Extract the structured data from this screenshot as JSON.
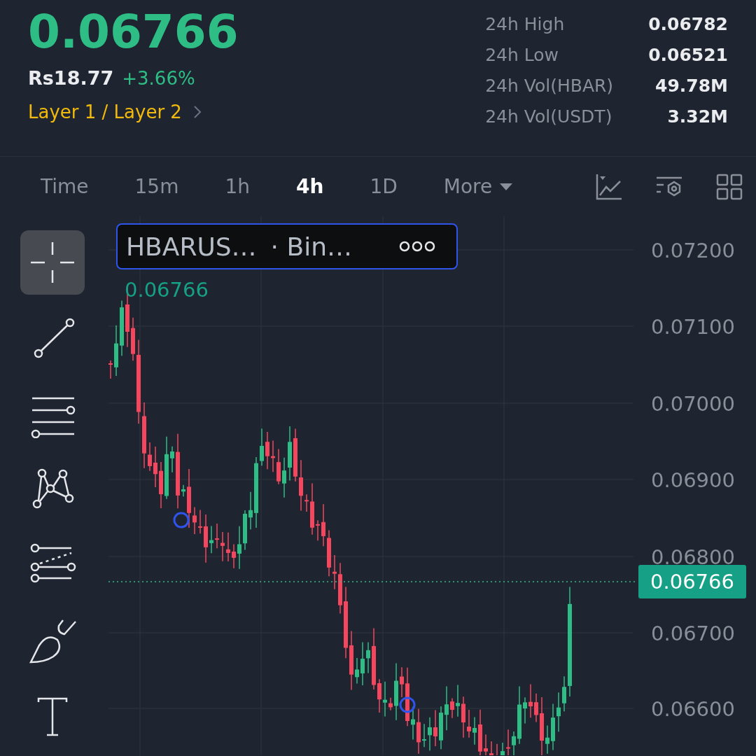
{
  "ticker": {
    "price": "0.06766",
    "fiat_price": "Rs18.77",
    "change": "+3.66%",
    "category": "Layer 1 / Layer 2"
  },
  "stats": [
    {
      "label": "24h High",
      "value": "0.06782"
    },
    {
      "label": "24h Low",
      "value": "0.06521"
    },
    {
      "label": "24h Vol(HBAR)",
      "value": "49.78M"
    },
    {
      "label": "24h Vol(USDT)",
      "value": "3.32M"
    }
  ],
  "timeframes": [
    {
      "label": "Time",
      "selected": false
    },
    {
      "label": "15m",
      "selected": false
    },
    {
      "label": "1h",
      "selected": false
    },
    {
      "label": "4h",
      "selected": true
    },
    {
      "label": "1D",
      "selected": false
    }
  ],
  "more": {
    "label": "More"
  },
  "drawing_tools": [
    {
      "kind": "crosshair",
      "selected": true
    },
    {
      "kind": "line",
      "selected": false
    },
    {
      "kind": "parallel",
      "selected": false
    },
    {
      "kind": "pattern",
      "selected": false
    },
    {
      "kind": "fib",
      "selected": false
    },
    {
      "kind": "brush",
      "selected": false
    },
    {
      "kind": "text",
      "selected": false
    }
  ],
  "chart": {
    "symbol": "HBARUS…",
    "exchange": "· Bin…",
    "high_label": "0.06766",
    "last_price": "0.06766",
    "y_axis_labels": [
      "0.07200",
      "0.07100",
      "0.07000",
      "0.06900",
      "0.06800",
      "0.06700",
      "0.06600"
    ]
  }
}
